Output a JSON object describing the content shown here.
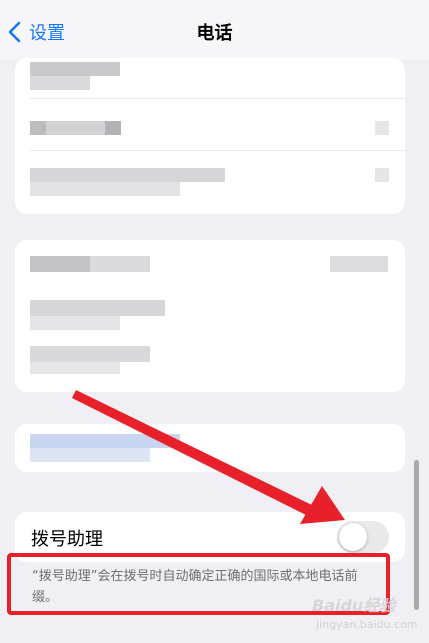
{
  "nav": {
    "back_label": "设置",
    "title": "电话"
  },
  "toggle": {
    "label": "拨号助理",
    "state": "off"
  },
  "footnote": "“拨号助理”会在拨号时自动确定正确的国际或本地电话前缀。",
  "watermark": {
    "text": "Baidu经验",
    "url": "jingyan.baidu.com"
  },
  "colors": {
    "accent": "#1677ff",
    "highlight": "#e8202a",
    "background": "#efeff4"
  }
}
